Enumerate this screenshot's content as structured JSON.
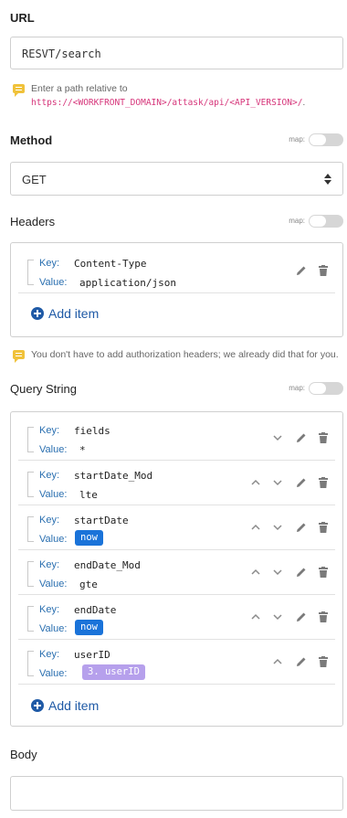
{
  "url": {
    "label": "URL",
    "value": "RESVT/search",
    "hint_prefix": "Enter a path relative to",
    "hint_path": "https://<WORKFRONT_DOMAIN>/attask/api/<API_VERSION>/",
    "hint_suffix": "."
  },
  "method": {
    "label": "Method",
    "map_label": "map:",
    "selected": "GET"
  },
  "headers": {
    "label": "Headers",
    "map_label": "map:",
    "key_label": "Key:",
    "value_label": "Value:",
    "items": [
      {
        "key": "Content-Type",
        "value": "application/json"
      }
    ],
    "add_item": "Add item",
    "hint": "You don't have to add authorization headers; we already did that for you."
  },
  "query_string": {
    "label": "Query String",
    "map_label": "map:",
    "key_label": "Key:",
    "value_label": "Value:",
    "items": [
      {
        "key": "fields",
        "value": "*"
      },
      {
        "key": "startDate_Mod",
        "value": "lte"
      },
      {
        "key": "startDate",
        "value": "now",
        "value_type": "pill-blue"
      },
      {
        "key": "endDate_Mod",
        "value": "gte"
      },
      {
        "key": "endDate",
        "value": "now",
        "value_type": "pill-blue"
      },
      {
        "key": "userID",
        "value": "3. userID",
        "value_type": "pill-purple"
      }
    ],
    "add_item": "Add item"
  },
  "body": {
    "label": "Body",
    "value": ""
  },
  "colors": {
    "accent_blue": "#1f5aa6",
    "pill_blue": "#1a73d9",
    "pill_purple": "#b6a0ec",
    "hint_path": "#d6357a",
    "hint_icon": "#f0c23b"
  }
}
